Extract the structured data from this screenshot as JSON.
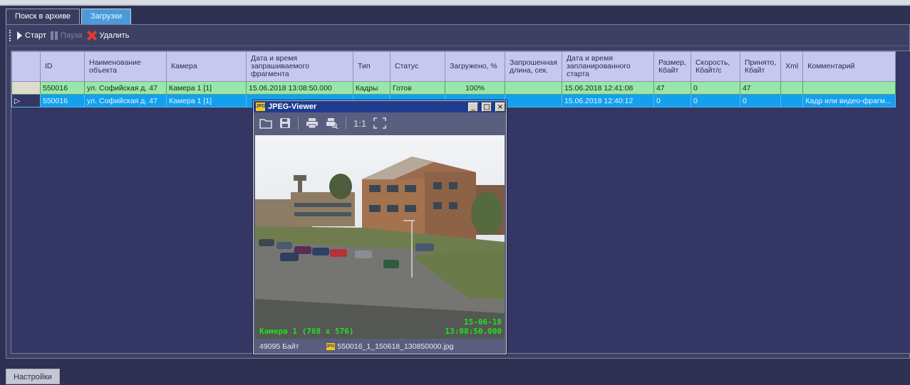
{
  "tabs": [
    {
      "label": "Поиск в архиве",
      "active": false
    },
    {
      "label": "Загрузки",
      "active": true
    }
  ],
  "toolbar": {
    "start_label": "Старт",
    "pause_label": "Пауза",
    "delete_label": "Удалить"
  },
  "table": {
    "headers": [
      "ID",
      "Наименование объекта",
      "Камера",
      "Дата и время запрашиваемого фрагмента",
      "Тип",
      "Статус",
      "Загружено, %",
      "Запрошенная длина, сек.",
      "Дата и время запланированного старта",
      "Размер, Кбайт",
      "Скорость, Кбайт/с",
      "Принято, Кбайт",
      "Xml",
      "Комментарий"
    ],
    "rows": [
      {
        "id": "550016",
        "object": "ул. Софийская д. 47",
        "camera": "Камера 1 [1]",
        "fragment_time": "15.06.2018 13:08:50.000",
        "type": "Кадры",
        "status": "Готов",
        "loaded": "100%",
        "length": "",
        "start_time": "15.06.2018 12:41:08",
        "size": "47",
        "speed": "0",
        "received": "47",
        "xml": "",
        "comment": ""
      },
      {
        "id": "550016",
        "object": "ул. Софийская д. 47",
        "camera": "Камера 1 [1]",
        "fragment_time": "",
        "type": "",
        "status": "",
        "loaded": "",
        "length": "",
        "start_time": "15.06.2018 12:40:12",
        "size": "0",
        "speed": "0",
        "received": "0",
        "xml": "",
        "comment": "Кадр или видео-фрагм..."
      }
    ]
  },
  "viewer": {
    "title": "JPEG-Viewer",
    "logo": "JPG",
    "zoom_label": "1:1",
    "caption_camera": "Камера 1 (768 x 576)",
    "caption_date": "15-06-18",
    "caption_time": "13:08:50.000",
    "file_size": "49095 Байт",
    "file_name": "550016_1_150618_130850000.jpg",
    "min_btn": "_",
    "max_btn": "□",
    "close_btn": "×"
  },
  "bottom_tab": {
    "label": "Настройки"
  }
}
